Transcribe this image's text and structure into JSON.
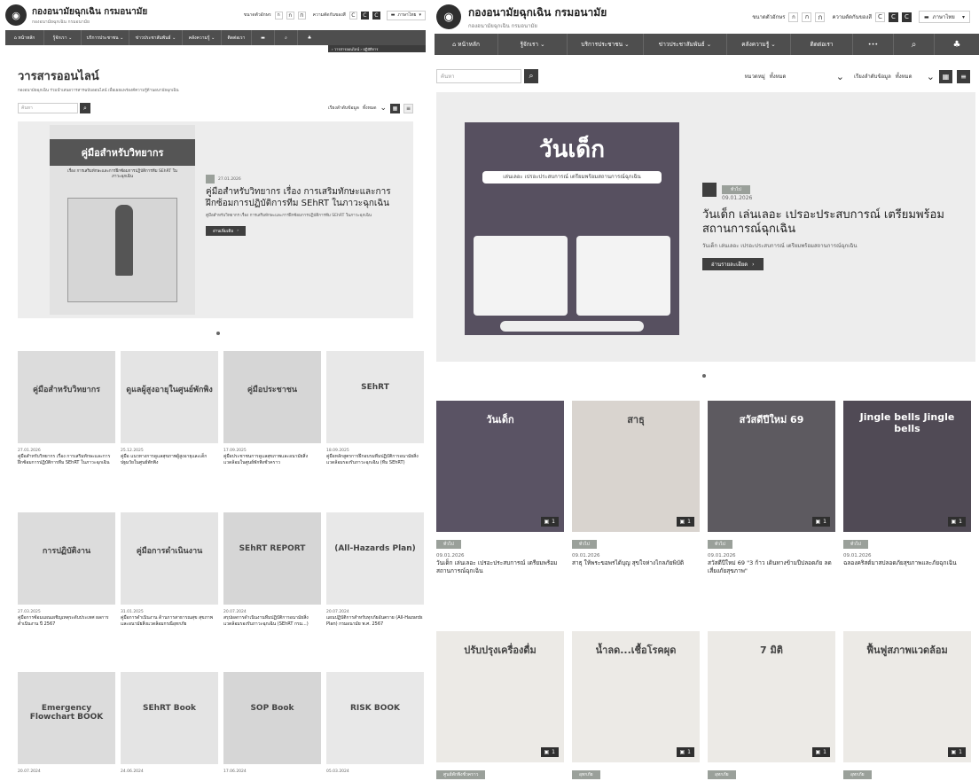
{
  "left": {
    "brand_title": "กองอนามัยฉุกเฉิน กรมอนามัย",
    "brand_sub": "กองอนามัยฉุกเฉิน กรมอนามัย",
    "font_size_label": "ขนาดตัวอักษร",
    "contrast_label": "ความตัดกันของสี",
    "lang_label": "ภาษาไทย",
    "nav": [
      "หน้าหลัก",
      "รู้จักเรา",
      "บริการประชาชน",
      "ข่าวประชาสัมพันธ์",
      "คลังความรู้",
      "ติดต่อเรา"
    ],
    "breadcrumb": "› วารสารออนไลน์ › ปฏิบัติการ",
    "page_title": "วารสารออนไลน์",
    "page_subtitle": "กองอนามัยฉุกเฉิน ร่วมนำเสนอวารสารฉบับออนไลน์ เพื่อเผยแพร่องค์ความรู้ด้านอนามัยฉุกเฉิน",
    "search_placeholder": "ค้นหา",
    "sort_label": "เรียงลำดับข้อมูล",
    "sort_value": "ทั้งหมด",
    "hero": {
      "poster_title": "คู่มือสำหรับวิทยากร",
      "poster_sub": "เรื่อง การเสริมทักษะและการฝึกซ้อมการปฏิบัติการทีม SEhRT ในภาวะฉุกเฉิน",
      "date": "27.01.2026",
      "title": "คู่มือสำหรับวิทยากร เรื่อง การเสริมทักษะและการฝึกซ้อมการปฏิบัติการทีม SEhRT ในภาวะฉุกเฉิน",
      "desc": "คู่มือสำหรับวิทยากร เรื่อง การเสริมทักษะและการฝึกซ้อมการปฏิบัติการทีม SEhRT ในภาวะฉุกเฉิน",
      "read_more": "อ่านเพิ่มเติม"
    },
    "cards": [
      {
        "poster": "คู่มือสำหรับวิทยากร",
        "date": "27.01.2026",
        "title": "คู่มือสำหรับวิทยากร เรื่อง การเสริมทักษะและการฝึกซ้อมการปฏิบัติการทีม SEhRT ในภาวะฉุกเฉิน"
      },
      {
        "poster": "ดูแลผู้สูงอายุในศูนย์พักพิง",
        "date": "25.12.2025",
        "title": "คู่มือ แนวทางการดูแลสุขภาพผู้สูงอายุและเด็กปฐมวัยในศูนย์พักพิง"
      },
      {
        "poster": "คู่มือประชาชน",
        "date": "17.09.2025",
        "title": "คู่มือประชาชนการดูแลสุขภาพและอนามัยสิ่งแวดล้อมในศูนย์พักพิงชั่วคราว"
      },
      {
        "poster": "SEhRT",
        "date": "18.09.2025",
        "title": "คู่มือหลักสูตรการฝึกอบรมทีมปฏิบัติการอนามัยสิ่งแวดล้อมรองรับภาวะฉุกเฉิน (ทีม SEhRT)"
      },
      {
        "poster": "การปฏิบัติงาน",
        "date": "27.03.2025",
        "title": "คู่มือการซ้อมแผนเผชิญเหตุระดับประเทศ ผลการดำเนินงาน ปี 2567"
      },
      {
        "poster": "คู่มือการดำเนินงาน",
        "date": "31.01.2025",
        "title": "คู่มือการดำเนินงาน ด้านการสาธารณสุข สุขภาพและอนามัยสิ่งแวดล้อมกรณีอุทกภัย"
      },
      {
        "poster": "SEhRT REPORT",
        "date": "20.07.2024",
        "title": "สรุปผลการดำเนินงานทีมปฏิบัติการอนามัยสิ่งแวดล้อมรองรับภาวะฉุกเฉิน (SEhRT กรม...)"
      },
      {
        "poster": "(All-Hazards Plan)",
        "date": "20.07.2024",
        "title": "แผนปฏิบัติการสำหรับทุกภัยอันตราย (All-Hazards Plan) กรมอนามัย พ.ศ. 2567"
      },
      {
        "poster": "Emergency Flowchart BOOK",
        "date": "20.07.2024",
        "title": ""
      },
      {
        "poster": "SEhRT Book",
        "date": "24.06.2024",
        "title": ""
      },
      {
        "poster": "SOP Book",
        "date": "17.06.2024",
        "title": ""
      },
      {
        "poster": "RISK BOOK",
        "date": "05.03.2024",
        "title": ""
      }
    ]
  },
  "right": {
    "brand_title": "กองอนามัยฉุกเฉิน กรมอนามัย",
    "brand_sub": "กองอนามัยฉุกเฉิน กรมอนามัย",
    "font_size_label": "ขนาดตัวอักษร",
    "contrast_label": "ความตัดกันของสี",
    "lang_label": "ภาษาไทย",
    "nav": [
      "หน้าหลัก",
      "รู้จักเรา",
      "บริการประชาชน",
      "ข่าวประชาสัมพันธ์",
      "คลังความรู้",
      "ติดต่อเรา"
    ],
    "search_placeholder": "ค้นหา",
    "category_label": "หมวดหมู่",
    "category_value": "ทั้งหมด",
    "sort_label": "เรียงลำดับข้อมูล",
    "sort_value": "ทั้งหมด",
    "hero": {
      "poster_title": "วันเด็ก",
      "poster_sub": "เล่นเลอะ เปรอะประสบการณ์ เตรียมพร้อมสถานการณ์ฉุกเฉิน",
      "tag": "ทั่วไป",
      "date": "09.01.2026",
      "title": "วันเด็ก เล่นเลอะ เปรอะประสบการณ์ เตรียมพร้อมสถานการณ์ฉุกเฉิน",
      "desc": "วันเด็ก เล่นเลอะ เปรอะประสบการณ์ เตรียมพร้อมสถานการณ์ฉุกเฉิน",
      "read_more": "อ่านรายละเอียด"
    },
    "cards": [
      {
        "poster": "วันเด็ก",
        "tag": "ทั่วไป",
        "count": "1",
        "date": "09.01.2026",
        "title": "วันเด็ก เล่นเลอะ เปรอะประสบการณ์ เตรียมพร้อมสถานการณ์ฉุกเฉิน"
      },
      {
        "poster": "สาธุ",
        "tag": "ทั่วไป",
        "count": "1",
        "date": "09.01.2026",
        "title": "สาธุ ให้พระขอพรได้บุญ สุขใจห่างไกลภัยพิบัติ"
      },
      {
        "poster": "สวัสดีปีใหม่ 69",
        "tag": "ทั่วไป",
        "count": "1",
        "date": "09.01.2026",
        "title": "สวัสดีปีใหม่ 69 \"3 ก้าว เดินทางข้ามปีปลอดภัย ลดเสี่ยงภัยสุขภาพ\""
      },
      {
        "poster": "Jingle bells Jingle bells",
        "tag": "ทั่วไป",
        "count": "1",
        "date": "09.01.2026",
        "title": "ฉลองคริสต์มาสปลอดภัยสุขภาพและภัยฉุกเฉิน"
      },
      {
        "poster": "ปรับปรุงเครื่องดื่ม",
        "tag": "ศูนย์พักพิงชั่วคราว",
        "count": "1",
        "date": "",
        "title": ""
      },
      {
        "poster": "น้ำลด...เชื้อโรคผุด",
        "tag": "อุทกภัย",
        "count": "1",
        "date": "",
        "title": ""
      },
      {
        "poster": "7 มิติ",
        "tag": "อุทกภัย",
        "count": "1",
        "date": "",
        "title": ""
      },
      {
        "poster": "ฟื้นฟูสภาพแวดล้อม",
        "tag": "อุทกภัย",
        "count": "1",
        "date": "",
        "title": ""
      }
    ]
  }
}
